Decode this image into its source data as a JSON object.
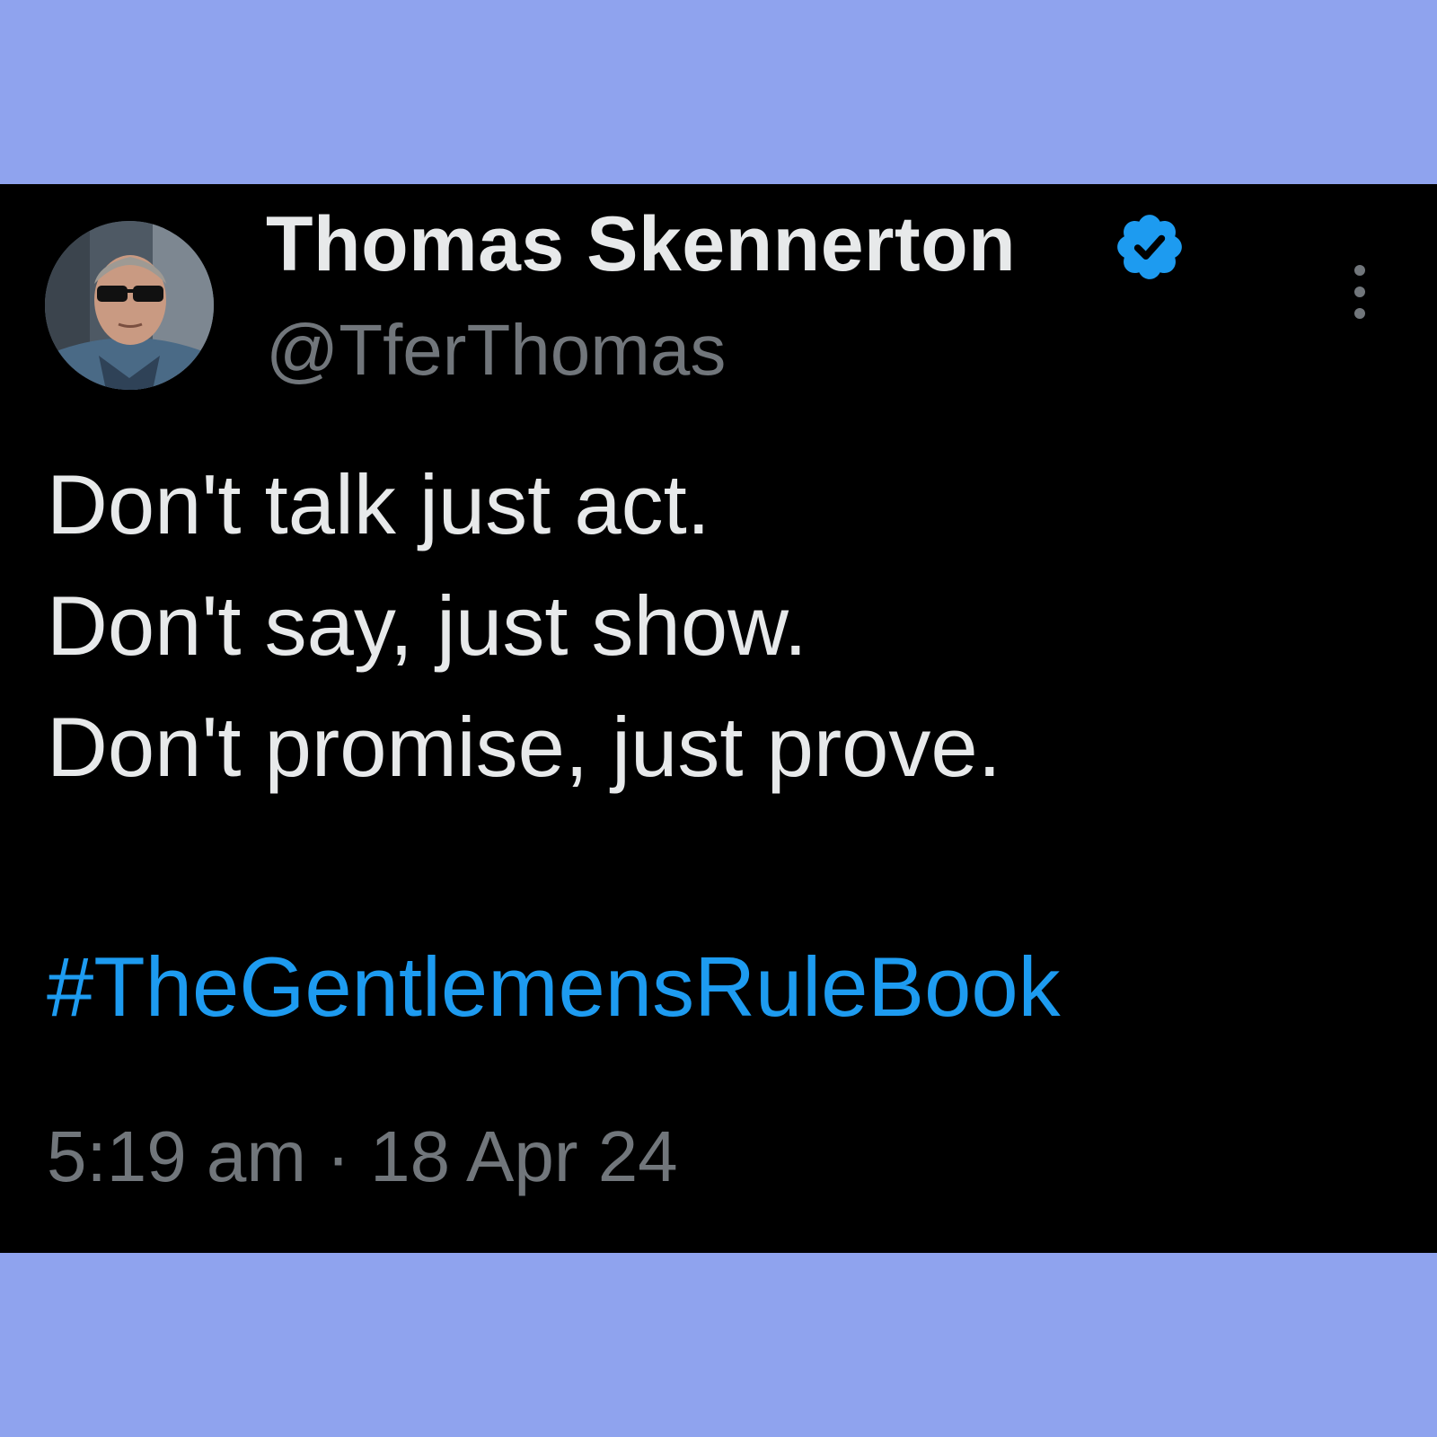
{
  "tweet": {
    "author": {
      "display_name": "Thomas Skennerton",
      "handle": "@TferThomas",
      "verified": true,
      "verified_badge_icon": "verified-badge-icon"
    },
    "text_lines": [
      "Don't talk just act.",
      "Don't say, just show.",
      "Don't promise, just prove."
    ],
    "hashtag": "#TheGentlemensRuleBook",
    "time": "5:19 am",
    "separator": "·",
    "date": "18 Apr 24",
    "more_options_icon": "more-vertical-icon"
  },
  "colors": {
    "frame_background": "#8fa3ee",
    "card_background": "#000000",
    "primary_text": "#e7e9ea",
    "secondary_text": "#71767b",
    "link": "#1d9bf0",
    "verified_badge": "#1d9bf0"
  }
}
